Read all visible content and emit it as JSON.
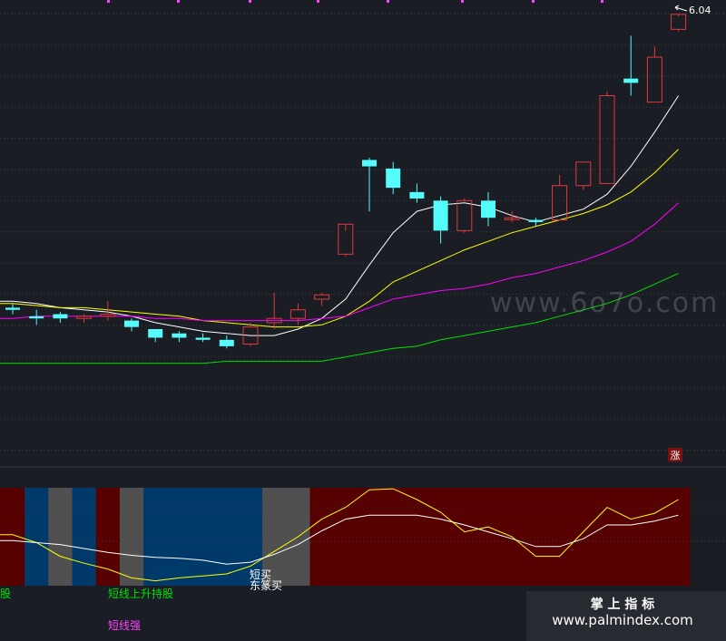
{
  "colors": {
    "background": "#1a1d24",
    "grid": "#3a3f4b",
    "up": "#e0393e",
    "down": "#54fcfc",
    "ma5": "#ffffff",
    "ma10": "#ffff00",
    "ma20": "#ff00ff",
    "ma60": "#00e000",
    "zone_dark_red": "#560000",
    "zone_blue": "#003a6a",
    "zone_gray": "#505050",
    "osc_yellow": "#ffff00",
    "osc_white": "#ffffff",
    "text_green": "#00e000",
    "text_magenta": "#ff44ff",
    "text_white": "#ffffff"
  },
  "price_label": "6.04",
  "rise_badge": "涨",
  "chart_data": [
    {
      "type": "candlestick",
      "title": "",
      "y_axis": {
        "range": [
          4.0,
          6.1
        ]
      },
      "candles": [
        {
          "o": 4.68,
          "h": 4.7,
          "l": 4.65,
          "c": 4.67
        },
        {
          "o": 4.64,
          "h": 4.67,
          "l": 4.6,
          "c": 4.63
        },
        {
          "o": 4.65,
          "h": 4.66,
          "l": 4.61,
          "c": 4.63
        },
        {
          "o": 4.63,
          "h": 4.65,
          "l": 4.61,
          "c": 4.64
        },
        {
          "o": 4.64,
          "h": 4.71,
          "l": 4.62,
          "c": 4.65
        },
        {
          "o": 4.62,
          "h": 4.63,
          "l": 4.57,
          "c": 4.59
        },
        {
          "o": 4.58,
          "h": 4.58,
          "l": 4.52,
          "c": 4.54
        },
        {
          "o": 4.56,
          "h": 4.57,
          "l": 4.52,
          "c": 4.54
        },
        {
          "o": 4.54,
          "h": 4.56,
          "l": 4.52,
          "c": 4.53
        },
        {
          "o": 4.53,
          "h": 4.55,
          "l": 4.49,
          "c": 4.5
        },
        {
          "o": 4.51,
          "h": 4.61,
          "l": 4.5,
          "c": 4.59
        },
        {
          "o": 4.61,
          "h": 4.75,
          "l": 4.58,
          "c": 4.63
        },
        {
          "o": 4.63,
          "h": 4.7,
          "l": 4.6,
          "c": 4.67
        },
        {
          "o": 4.72,
          "h": 4.75,
          "l": 4.69,
          "c": 4.74
        },
        {
          "o": 4.93,
          "h": 5.04,
          "l": 4.92,
          "c": 5.07
        },
        {
          "o": 5.37,
          "h": 5.38,
          "l": 5.13,
          "c": 5.34
        },
        {
          "o": 5.33,
          "h": 5.36,
          "l": 5.21,
          "c": 5.24
        },
        {
          "o": 5.22,
          "h": 5.26,
          "l": 5.17,
          "c": 5.19
        },
        {
          "o": 5.18,
          "h": 5.2,
          "l": 4.98,
          "c": 5.04
        },
        {
          "o": 5.04,
          "h": 5.19,
          "l": 5.03,
          "c": 5.18
        },
        {
          "o": 5.18,
          "h": 5.22,
          "l": 5.06,
          "c": 5.1
        },
        {
          "o": 5.1,
          "h": 5.13,
          "l": 5.08,
          "c": 5.1
        },
        {
          "o": 5.09,
          "h": 5.1,
          "l": 5.06,
          "c": 5.08
        },
        {
          "o": 5.09,
          "h": 5.3,
          "l": 5.09,
          "c": 5.25
        },
        {
          "o": 5.25,
          "h": 5.36,
          "l": 5.23,
          "c": 5.36
        },
        {
          "o": 5.26,
          "h": 5.69,
          "l": 5.26,
          "c": 5.67
        },
        {
          "o": 5.75,
          "h": 5.95,
          "l": 5.67,
          "c": 5.73
        },
        {
          "o": 5.64,
          "h": 5.9,
          "l": 5.64,
          "c": 5.85
        },
        {
          "o": 5.98,
          "h": 6.04,
          "l": 5.97,
          "c": 6.05
        }
      ],
      "series": [
        {
          "color": "#ffffff",
          "values": [
            4.71,
            4.7,
            4.68,
            4.67,
            4.66,
            4.64,
            4.61,
            4.59,
            4.57,
            4.56,
            4.55,
            4.55,
            4.58,
            4.63,
            4.72,
            4.88,
            5.03,
            5.13,
            5.16,
            5.17,
            5.15,
            5.11,
            5.08,
            5.11,
            5.14,
            5.21,
            5.34,
            5.5,
            5.67
          ]
        },
        {
          "color": "#ffff00",
          "values": [
            4.7,
            4.69,
            4.68,
            4.68,
            4.67,
            4.66,
            4.65,
            4.64,
            4.62,
            4.61,
            4.6,
            4.59,
            4.59,
            4.6,
            4.64,
            4.71,
            4.8,
            4.85,
            4.9,
            4.95,
            4.99,
            5.03,
            5.06,
            5.09,
            5.12,
            5.16,
            5.22,
            5.31,
            5.42
          ]
        },
        {
          "color": "#ff00ff",
          "values": [
            4.63,
            4.64,
            4.64,
            4.64,
            4.64,
            4.64,
            4.63,
            4.63,
            4.62,
            4.62,
            4.62,
            4.62,
            4.62,
            4.63,
            4.64,
            4.68,
            4.72,
            4.74,
            4.76,
            4.77,
            4.79,
            4.82,
            4.84,
            4.87,
            4.9,
            4.94,
            4.99,
            5.07,
            5.17
          ]
        },
        {
          "color": "#00e000",
          "values": [
            4.42,
            4.42,
            4.42,
            4.42,
            4.42,
            4.42,
            4.42,
            4.42,
            4.42,
            4.43,
            4.43,
            4.43,
            4.43,
            4.43,
            4.45,
            4.47,
            4.49,
            4.5,
            4.53,
            4.55,
            4.57,
            4.59,
            4.61,
            4.64,
            4.67,
            4.7,
            4.74,
            4.79,
            4.84
          ]
        }
      ]
    },
    {
      "type": "line",
      "title": "",
      "y_axis": {
        "range": [
          0,
          100
        ]
      },
      "zones": [
        "dark_red",
        "blue",
        "gray",
        "blue",
        "dark_red",
        "gray",
        "blue",
        "blue",
        "blue",
        "blue",
        "blue",
        "gray",
        "gray",
        "dark_red",
        "dark_red",
        "dark_red",
        "dark_red",
        "dark_red",
        "dark_red",
        "dark_red",
        "dark_red",
        "dark_red",
        "dark_red",
        "dark_red",
        "dark_red",
        "dark_red",
        "dark_red",
        "dark_red",
        "dark_red"
      ],
      "series": [
        {
          "color": "#ffff00",
          "values": [
            52,
            44,
            30,
            23,
            17,
            8,
            5,
            8,
            10,
            12,
            20,
            35,
            50,
            68,
            80,
            98,
            99,
            88,
            75,
            55,
            60,
            50,
            30,
            30,
            55,
            80,
            68,
            74,
            88
          ]
        },
        {
          "color": "#ffffff",
          "values": [
            46,
            44,
            42,
            38,
            34,
            31,
            29,
            28,
            26,
            22,
            24,
            32,
            42,
            56,
            68,
            72,
            72,
            72,
            68,
            62,
            55,
            48,
            40,
            40,
            48,
            62,
            62,
            66,
            72
          ]
        }
      ]
    }
  ],
  "signals": [
    {
      "text": "股",
      "color": "#00e000"
    },
    {
      "text": "短线上升持股",
      "color": "#00e000"
    },
    {
      "text": "短买",
      "color": "#ffffff"
    },
    {
      "text": "东篆买",
      "color": "#ffffff"
    },
    {
      "text": "短线强",
      "color": "#ff44ff"
    }
  ],
  "watermarks": {
    "center": "www.6o7o.com",
    "corner_title": "掌 上 指 标",
    "corner_url": "www.palmindex.com"
  }
}
